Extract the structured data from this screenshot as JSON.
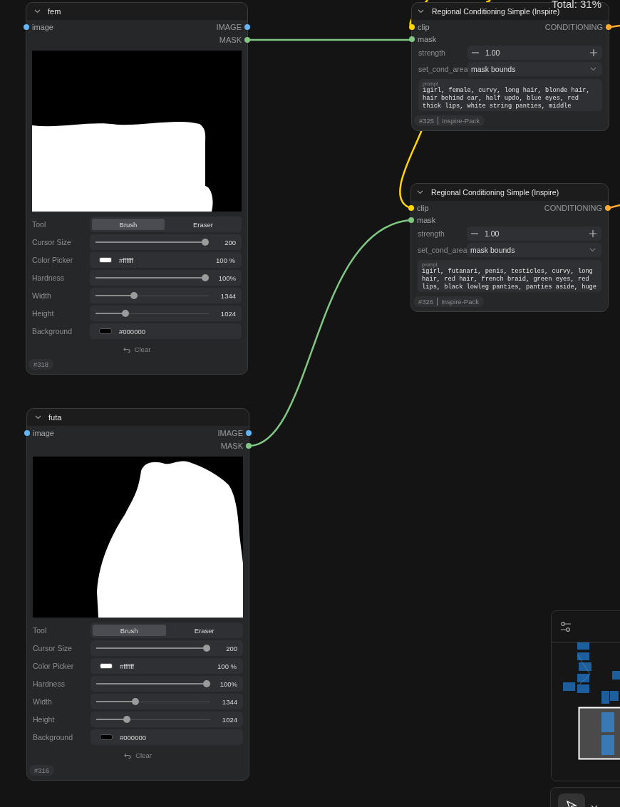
{
  "status_text": "Total: 31%",
  "nodes": [
    {
      "kind": "mask_editor",
      "title": "fem",
      "expanded": true,
      "inputs": [
        {
          "label": "image",
          "color": "#64b5f6"
        }
      ],
      "outputs": [
        {
          "label": "IMAGE",
          "color": "#64b5f6"
        },
        {
          "label": "MASK",
          "color": "#81c784"
        }
      ],
      "widgets": [
        {
          "kind": "toggle",
          "label": "Tool",
          "options": [
            {
              "label": "Brush",
              "selected": true
            },
            {
              "label": "Eraser",
              "selected": false
            }
          ]
        },
        {
          "kind": "slider",
          "label": "Cursor Size",
          "level": 1.0,
          "value": "200"
        },
        {
          "kind": "color",
          "label": "Color Picker",
          "color": "#ffffff",
          "value": "#ffffff",
          "extra": "100 %"
        },
        {
          "kind": "slider",
          "label": "Hardness",
          "level": 1.0,
          "value": "100%"
        },
        {
          "kind": "slider",
          "label": "Width",
          "level": 0.33,
          "value": "1344"
        },
        {
          "kind": "slider",
          "label": "Height",
          "level": 0.25,
          "value": "1024"
        },
        {
          "kind": "color",
          "label": "Background",
          "color": "#000000",
          "value": "#000000"
        },
        {
          "kind": "button",
          "label": "Clear"
        }
      ],
      "badges": [
        "#318"
      ]
    },
    {
      "kind": "regional",
      "title": "Regional Conditioning Simple (Inspire)",
      "expanded": true,
      "inputs": [
        {
          "label": "clip",
          "color": "#ffd500"
        },
        {
          "label": "mask",
          "color": "#81c784"
        }
      ],
      "outputs": [
        {
          "label": "CONDITIONING",
          "color": "#ffa931"
        }
      ],
      "widgets": [
        {
          "kind": "number",
          "label": "strength",
          "value": "1.00"
        },
        {
          "kind": "combo",
          "label": "set_cond_area",
          "value": "mask bounds"
        },
        {
          "kind": "prompt",
          "label": "prompt",
          "lines": [
            "1girl, female, curvy, long hair, blonde hair,",
            "hair behind ear, half updo, blue eyes, red",
            "thick lips, white string panties, middle"
          ]
        }
      ],
      "badges": [
        "#325",
        "Inspire-Pack"
      ]
    },
    {
      "kind": "regional",
      "title": "Regional Conditioning Simple (Inspire)",
      "expanded": true,
      "inputs": [
        {
          "label": "clip",
          "color": "#ffd500"
        },
        {
          "label": "mask",
          "color": "#81c784"
        }
      ],
      "outputs": [
        {
          "label": "CONDITIONING",
          "color": "#ffa931"
        }
      ],
      "widgets": [
        {
          "kind": "number",
          "label": "strength",
          "value": "1.00"
        },
        {
          "kind": "combo",
          "label": "set_cond_area",
          "value": "mask bounds"
        },
        {
          "kind": "prompt",
          "label": "prompt",
          "lines": [
            "1girl, futanari, penis, testicles, curvy, long",
            "hair, red hair, french braid, green eyes, red",
            "lips, black lowleg panties, panties aside, huge"
          ]
        }
      ],
      "badges": [
        "#326",
        "Inspire-Pack"
      ]
    },
    {
      "kind": "mask_editor",
      "title": "futa",
      "expanded": true,
      "inputs": [
        {
          "label": "image",
          "color": "#64b5f6"
        }
      ],
      "outputs": [
        {
          "label": "IMAGE",
          "color": "#64b5f6"
        },
        {
          "label": "MASK",
          "color": "#81c784"
        }
      ],
      "widgets": [
        {
          "kind": "toggle",
          "label": "Tool",
          "options": [
            {
              "label": "Brush",
              "selected": true
            },
            {
              "label": "Eraser",
              "selected": false
            }
          ]
        },
        {
          "kind": "slider",
          "label": "Cursor Size",
          "level": 1.0,
          "value": "200"
        },
        {
          "kind": "color",
          "label": "Color Picker",
          "color": "#ffffff",
          "value": "#ffffff",
          "extra": "100 %"
        },
        {
          "kind": "slider",
          "label": "Hardness",
          "level": 1.0,
          "value": "100%"
        },
        {
          "kind": "slider",
          "label": "Width",
          "level": 0.33,
          "value": "1344"
        },
        {
          "kind": "slider",
          "label": "Height",
          "level": 0.25,
          "value": "1024"
        },
        {
          "kind": "color",
          "label": "Background",
          "color": "#000000",
          "value": "#000000"
        },
        {
          "kind": "button",
          "label": "Clear"
        }
      ],
      "badges": [
        "#316"
      ]
    }
  ]
}
